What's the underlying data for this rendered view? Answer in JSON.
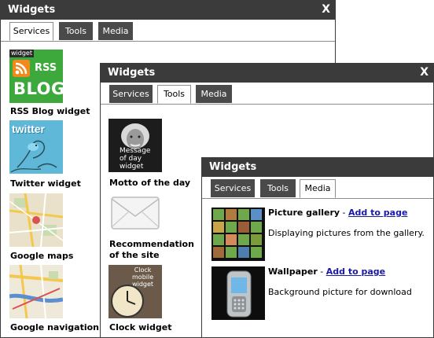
{
  "windows": {
    "services": {
      "title": "Widgets",
      "close": "X",
      "tabs": [
        "Services",
        "Tools",
        "Media"
      ],
      "items": [
        {
          "label": "RSS Blog widget",
          "badge": "widget",
          "rss": "RSS",
          "blog": "BLOG"
        },
        {
          "label": "Twitter widget",
          "logo": "twitter"
        },
        {
          "label": "Google maps"
        },
        {
          "label": "Google navigation"
        }
      ]
    },
    "tools": {
      "title": "Widgets",
      "close": "X",
      "tabs": [
        "Services",
        "Tools",
        "Media"
      ],
      "items": [
        {
          "label": "Motto of the day",
          "caption": [
            "Message",
            "of day",
            "widget"
          ]
        },
        {
          "label_lines": [
            "Recommendation",
            "of the site"
          ]
        },
        {
          "label": "Clock widget",
          "caption": [
            "Clock",
            "mobile",
            "widget"
          ]
        }
      ]
    },
    "media": {
      "title": "Widgets",
      "close": "X",
      "tabs": [
        "Services",
        "Tools",
        "Media"
      ],
      "items": [
        {
          "title": "Picture gallery",
          "sep": " - ",
          "link": "Add to page",
          "desc": "Displaying pictures from the gallery."
        },
        {
          "title": "Wallpaper",
          "sep": " - ",
          "link": "Add to page",
          "desc": "Background picture for download"
        }
      ]
    }
  },
  "colors": {
    "titlebar": "#3b3b3b",
    "tab_inactive": "#4a4a4a",
    "link": "#1a1aa6",
    "rss_green": "#3da83c",
    "rss_orange": "#f08a1c"
  }
}
